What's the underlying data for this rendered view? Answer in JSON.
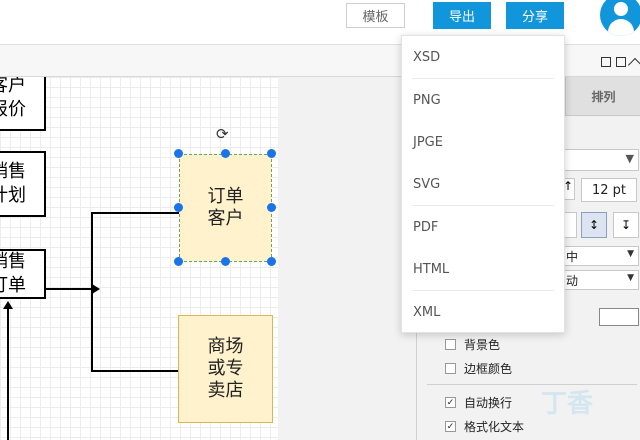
{
  "header": {
    "template_label": "模板",
    "export_label": "导出",
    "share_label": "分享"
  },
  "export_menu": {
    "items": [
      "XSD",
      "PNG",
      "JPGE",
      "SVG",
      "PDF",
      "HTML",
      "XML"
    ]
  },
  "canvas": {
    "nodes": [
      {
        "label": "客户\n报价"
      },
      {
        "label": "销售\n计划"
      },
      {
        "label": "销售\n订单"
      }
    ],
    "boxes": [
      {
        "label": "订单\n客户"
      },
      {
        "label": "商场\n或专\n卖店"
      }
    ]
  },
  "panel": {
    "tab_arrange": "排列",
    "font_size": "12 pt",
    "vertical_align": "中",
    "text_direction": "动",
    "checks": [
      {
        "label": "背景色",
        "checked": false
      },
      {
        "label": "边框颜色",
        "checked": false
      },
      {
        "label": "自动换行",
        "checked": true
      },
      {
        "label": "格式化文本",
        "checked": true
      }
    ],
    "watermark": "丁香"
  },
  "colors": {
    "accent": "#1296db",
    "box_fill": "#fff2cc",
    "box_border": "#d6b656",
    "handle": "#1a73e8"
  }
}
